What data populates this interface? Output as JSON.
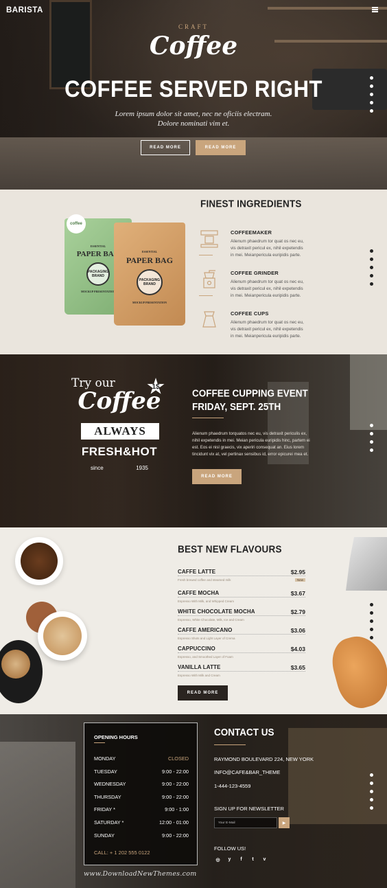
{
  "brand": {
    "logo": "BARISTA"
  },
  "hero": {
    "craft": "CRAFT",
    "script": "Coffee",
    "title": "COFFEE SERVED RIGHT",
    "subtitle": "Lorem ipsum dolor sit amet, nec ne oficiis electram. Dolore nominati vim et.",
    "btn_read_more_1": "READ MORE",
    "btn_read_more_2": "READ MORE"
  },
  "ingredients": {
    "title": "FINEST INGREDIENTS",
    "bag_green": {
      "badge": "coffee",
      "top": "ESSENTIAL",
      "name": "PAPER BAG",
      "seal": "PACKAGING BRAND",
      "bottom": "MOCKUP PRESENTATION"
    },
    "bag_brown": {
      "top": "ESSENTIAL",
      "name": "PAPER BAG",
      "seal": "PACKAGING BRAND",
      "bottom": "MOCKUP PRESENTATION"
    },
    "items": [
      {
        "icon": "coffeemaker-icon",
        "title": "COFFEEMAKER",
        "text": "Alienum phaedrum tor quat os nec eu, vis detraxit pericul ex, nihil expetendis in mei. Meianpericula euripidis parte."
      },
      {
        "icon": "coffee-grinder-icon",
        "title": "COFFEE GRINDER",
        "text": "Alienum phaedrum tor quat os nec eu, vis detraxit pericul ex, nihil expetendis in mei. Meianpericula euripidis parte."
      },
      {
        "icon": "coffee-cup-icon",
        "title": "COFFEE CUPS",
        "text": "Alienum phaedrum tor quat os nec eu, vis detraxit pericul ex, nihil expetendis in mei. Meianpericula euripidis parte."
      }
    ]
  },
  "event": {
    "promo": {
      "try": "Try our",
      "coffee": "Coffee",
      "price": "1$",
      "always": "ALWAYS",
      "fresh": "FRESH&HOT",
      "since": "since",
      "year": "1935"
    },
    "title_1": "COFFEE CUPPING EVENT",
    "title_2": "FRIDAY, SEPT. 25TH",
    "text": "Alienum phaedrum torquatos nec eu, vis detraxit periculis ex, nihil expetendis in mei. Meian pericula euripidis hinc, partem ei est. Eos ei nisl graecis, vix aperiri consequat an. Eius lorem tincidunt vix at, vel pertinax sensibus id, error epicurei mea et.",
    "btn": "READ MORE"
  },
  "flavours": {
    "title": "BEST NEW FLAVOURS",
    "items": [
      {
        "name": "CAFFE LATTE",
        "price": "$2.95",
        "desc": "Fresh brewed coffee and steamed milk",
        "badge": "New"
      },
      {
        "name": "CAFFE MOCHA",
        "price": "$3.67",
        "desc": "Espresso With Milk, and Whipped Cream",
        "badge": ""
      },
      {
        "name": "WHITE CHOCOLATE MOCHA",
        "price": "$2.79",
        "desc": "Espresso, White Chocolate, Milk, Ice and Cream",
        "badge": ""
      },
      {
        "name": "CAFFE AMERICANO",
        "price": "$3.06",
        "desc": "Espresso Shots and Light Layer of Crema",
        "badge": ""
      },
      {
        "name": "CAPPUCCINO",
        "price": "$4.03",
        "desc": "Espresso, and Smoothed Layer of Foam",
        "badge": ""
      },
      {
        "name": "VANILLA LATTE",
        "price": "$3.65",
        "desc": "Espresso With Milk and Cream",
        "badge": ""
      }
    ],
    "btn": "READ MORE"
  },
  "hours": {
    "title": "OPENING HOURS",
    "rows": [
      {
        "day": "MONDAY",
        "time": "CLOSED"
      },
      {
        "day": "TUESDAY",
        "time": "9:00 - 22:00"
      },
      {
        "day": "WEDNESDAY",
        "time": "9:00 - 22:00"
      },
      {
        "day": "THURSDAY",
        "time": "9:00 - 22:00"
      },
      {
        "day": "FRIDAY *",
        "time": "9:00 - 1:00"
      },
      {
        "day": "SATURDAY *",
        "time": "12:00 - 01:00"
      },
      {
        "day": "SUNDAY",
        "time": "9:00 - 22:00"
      }
    ],
    "call": "CALL: + 1 202 555 0122"
  },
  "contact": {
    "title": "CONTACT US",
    "address": "RAYMOND BOULEVARD 224, NEW YORK",
    "email": "INFO@CAFE&BAR_THEME",
    "phone": "1-444-123-4559",
    "newsletter": "SIGN UP FOR NEWSLETTER",
    "email_placeholder": "Your E-Mail",
    "follow": "FOLLOW US!",
    "social": [
      "instagram-icon",
      "twitter-icon",
      "facebook-icon",
      "tumblr-icon",
      "vimeo-icon"
    ]
  },
  "watermark": "www.DownloadNewThemes.com",
  "colors": {
    "accent": "#c9a57d",
    "dark": "#2a2420",
    "light_bg": "#eae5dd"
  }
}
